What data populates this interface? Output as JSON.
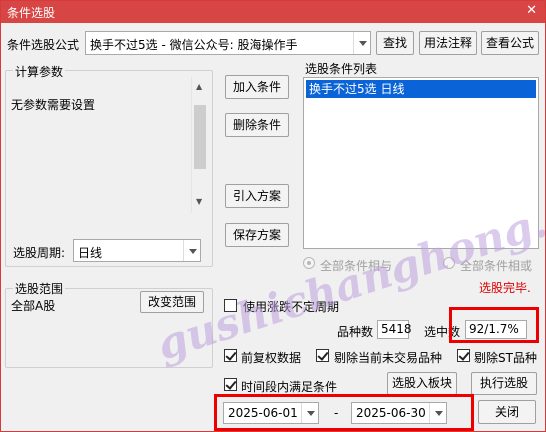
{
  "window": {
    "title": "条件选股",
    "close_glyph": "✕"
  },
  "formula": {
    "label": "条件选股公式",
    "value": "换手不过5选  -  微信公众号: 股海操作手",
    "find_button": "查找",
    "usage_button": "用法注释",
    "view_button": "查看公式"
  },
  "params": {
    "group_label": "计算参数",
    "text": "无参数需要设置",
    "period_label": "选股周期:",
    "period_value": "日线"
  },
  "actions": {
    "add": "加入条件",
    "delete": "删除条件",
    "import": "引入方案",
    "save": "保存方案"
  },
  "conditions": {
    "label": "选股条件列表",
    "items": [
      "换手不过5选  日线"
    ],
    "radio_and": "全部条件相与",
    "radio_or": "全部条件相或",
    "status": "选股完毕."
  },
  "scope": {
    "group_label": "选股范围",
    "value": "全部A股",
    "change_button": "改变范围"
  },
  "options": {
    "use_period_label": "使用涨跌不定周期",
    "count_label": "品种数",
    "count_value": "5418",
    "selected_label": "选中数",
    "selected_value": "92/1.7%",
    "adjust_label": "前复权数据",
    "exclude_untraded_label": "剔除当前未交易品种",
    "exclude_st_label": "剔除ST品种",
    "time_range_label": "时间段内满足条件",
    "to_block_button": "选股入板块",
    "run_button": "执行选股",
    "date_from": "2025-06-01",
    "date_sep": "-",
    "date_to": "2025-06-30",
    "close_button": "关闭"
  },
  "watermark": "gushichanghong.com",
  "colors": {
    "title_bar": "#d84545",
    "selection": "#0a64d8",
    "status_red": "#e00000",
    "highlight_box": "#ee0000"
  }
}
